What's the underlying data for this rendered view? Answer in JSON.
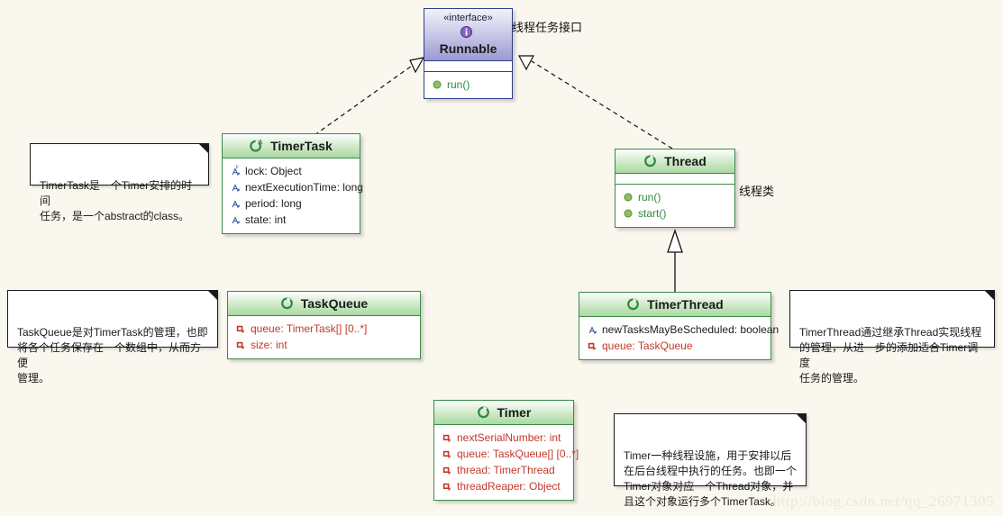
{
  "diagram": {
    "type": "uml-class-diagram",
    "background": "#faf7ef",
    "watermark": "http://blog.csdn.net/qq_26971305"
  },
  "classes": {
    "runnable": {
      "stereotype": "«interface»",
      "name": "Runnable",
      "icon": "interface-icon",
      "attributes": [],
      "operations": [
        {
          "visibility": "public",
          "text": "run()"
        }
      ]
    },
    "timertask": {
      "name": "TimerTask",
      "icon": "abstract-class-icon",
      "attributes": [
        {
          "visibility": "package-final",
          "text": "lock: Object"
        },
        {
          "visibility": "package",
          "text": "nextExecutionTime: long"
        },
        {
          "visibility": "package",
          "text": "period: long"
        },
        {
          "visibility": "package",
          "text": "state: int"
        }
      ],
      "operations": []
    },
    "thread": {
      "name": "Thread",
      "icon": "class-icon",
      "attributes": [],
      "operations": [
        {
          "visibility": "public",
          "text": "run()"
        },
        {
          "visibility": "public",
          "text": "start()"
        }
      ]
    },
    "taskqueue": {
      "name": "TaskQueue",
      "icon": "class-icon",
      "attributes": [
        {
          "visibility": "private",
          "text": "queue: TimerTask[] [0..*]"
        },
        {
          "visibility": "private",
          "text": "size: int"
        }
      ],
      "operations": []
    },
    "timerthread": {
      "name": "TimerThread",
      "icon": "class-icon",
      "attributes": [
        {
          "visibility": "package",
          "text": "newTasksMayBeScheduled: boolean"
        },
        {
          "visibility": "private",
          "text": "queue: TaskQueue"
        }
      ],
      "operations": []
    },
    "timer": {
      "name": "Timer",
      "icon": "class-icon",
      "attributes": [
        {
          "visibility": "private",
          "text": "nextSerialNumber: int"
        },
        {
          "visibility": "private",
          "text": "queue: TaskQueue[] [0..*]"
        },
        {
          "visibility": "private",
          "text": "thread: TimerThread"
        },
        {
          "visibility": "private",
          "text": "threadReaper: Object"
        }
      ],
      "operations": []
    }
  },
  "labels": {
    "runnable_label": "线程任务接口",
    "thread_label": "线程类"
  },
  "notes": {
    "timertask_note": "TimerTask是一个Timer安排的时间\n任务，是一个abstract的class。",
    "taskqueue_note": "TaskQueue是对TimerTask的管理，也即\n将各个任务保存在一个数组中，从而方便\n管理。",
    "timerthread_note": "TimerThread通过继承Thread实现线程\n的管理，从进一步的添加适合Timer调度\n任务的管理。",
    "timer_note": "Timer一种线程设施，用于安排以后\n在后台线程中执行的任务。也即一个\nTimer对象对应一个Thread对象，并\n且这个对象运行多个TimerTask。"
  },
  "relationships": [
    {
      "from": "TimerTask",
      "to": "Runnable",
      "kind": "realization"
    },
    {
      "from": "Thread",
      "to": "Runnable",
      "kind": "realization"
    },
    {
      "from": "TimerThread",
      "to": "Thread",
      "kind": "generalization"
    }
  ]
}
